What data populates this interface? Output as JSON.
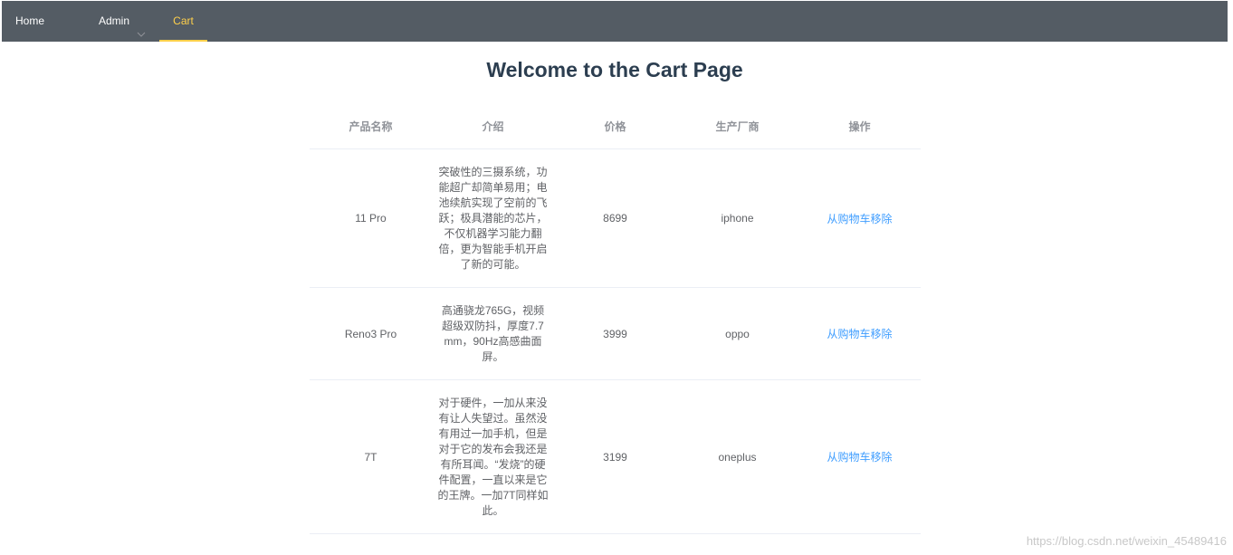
{
  "nav": {
    "home": "Home",
    "admin": "Admin",
    "cart": "Cart",
    "bg_color": "#545c64",
    "active_color": "#ffd04b"
  },
  "page": {
    "title": "Welcome to the Cart Page"
  },
  "table": {
    "headers": [
      "产品名称",
      "介绍",
      "价格",
      "生产厂商",
      "操作"
    ],
    "rows": [
      {
        "name": "11 Pro",
        "description": "突破性的三摄系统，功能超广却简单易用；电池续航实现了空前的飞跃；极具潜能的芯片，不仅机器学习能力翻倍，更为智能手机开启了新的可能。",
        "price": "8699",
        "manufacturer": "iphone",
        "action": "从购物车移除"
      },
      {
        "name": "Reno3 Pro",
        "description": "高通骁龙765G，视频超级双防抖，厚度7.7mm，90Hz高感曲面屏。",
        "price": "3999",
        "manufacturer": "oppo",
        "action": "从购物车移除"
      },
      {
        "name": "7T",
        "description": "对于硬件，一加从来没有让人失望过。虽然没有用过一加手机，但是对于它的发布会我还是有所耳闻。“发烧”的硬件配置，一直以来是它的王牌。一加7T同样如此。",
        "price": "3199",
        "manufacturer": "oneplus",
        "action": "从购物车移除"
      }
    ],
    "link_color": "#409eff"
  },
  "watermark": "https://blog.csdn.net/weixin_45489416"
}
